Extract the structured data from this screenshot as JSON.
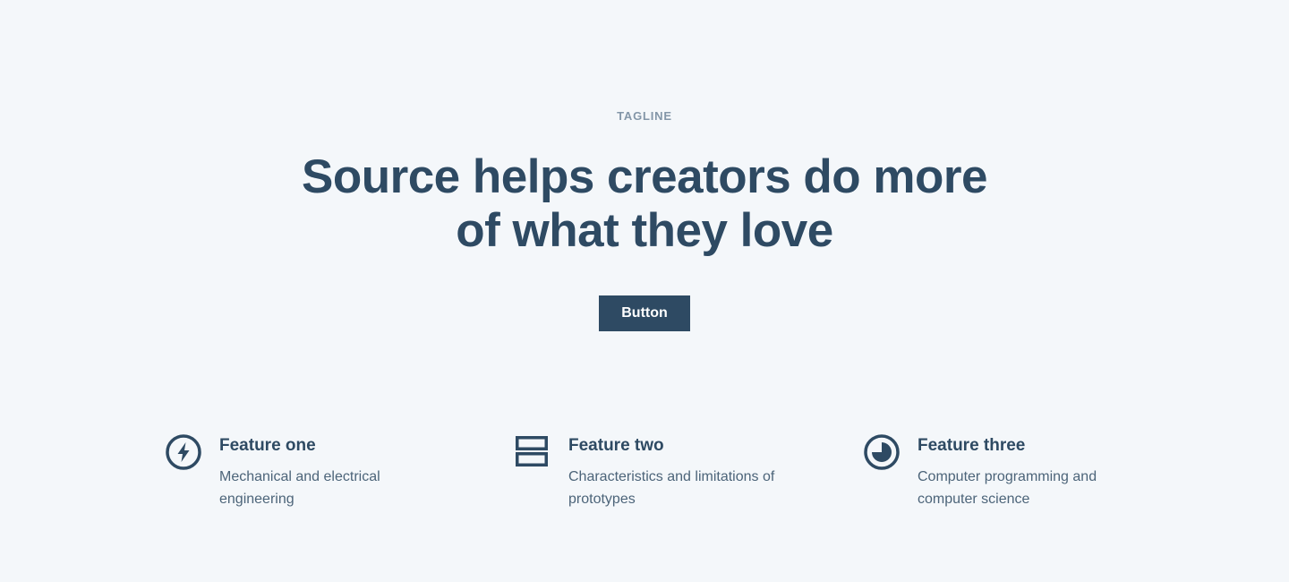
{
  "hero": {
    "tagline": "TAGLINE",
    "headline": "Source helps creators do more of what they love",
    "button_label": "Button"
  },
  "features": [
    {
      "icon": "lightning-icon",
      "title": "Feature one",
      "description": "Mechanical and electrical engineering"
    },
    {
      "icon": "stacked-rows-icon",
      "title": "Feature two",
      "description": "Characteristics and limitations of prototypes"
    },
    {
      "icon": "pie-chart-icon",
      "title": "Feature three",
      "description": "Computer programming and computer science"
    }
  ],
  "colors": {
    "background": "#f4f7fa",
    "primary": "#2e4a63",
    "muted": "#8396a8"
  }
}
